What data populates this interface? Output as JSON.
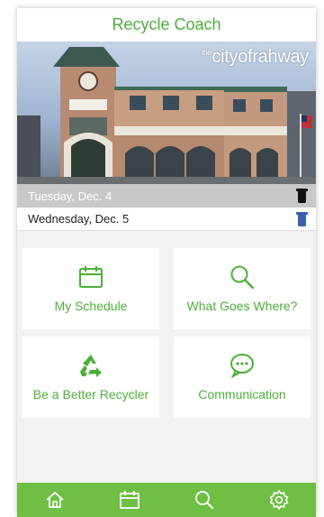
{
  "app": {
    "title": "Recycle Coach"
  },
  "hero": {
    "brand_prefix": "the",
    "brand_name": "cityofrahway"
  },
  "schedule": [
    {
      "label": "Tuesday, Dec. 4",
      "state": "past",
      "bin_icon": "trash-bin-icon",
      "bin_color": "#111111"
    },
    {
      "label": "Wednesday, Dec. 5",
      "state": "upcoming",
      "bin_icon": "recycling-bin-icon",
      "bin_color": "#3a5fb0"
    }
  ],
  "tiles": [
    {
      "label": "My Schedule",
      "icon": "calendar-icon"
    },
    {
      "label": "What Goes Where?",
      "icon": "search-icon"
    },
    {
      "label": "Be a Better Recycler",
      "icon": "recycle-icon"
    },
    {
      "label": "Communication",
      "icon": "chat-bubble-icon"
    }
  ],
  "bottom_nav": [
    "home-icon",
    "calendar-icon",
    "search-icon",
    "gear-icon"
  ],
  "colors": {
    "brand_green": "#4caf3a",
    "bar_green": "#6fbf45"
  }
}
